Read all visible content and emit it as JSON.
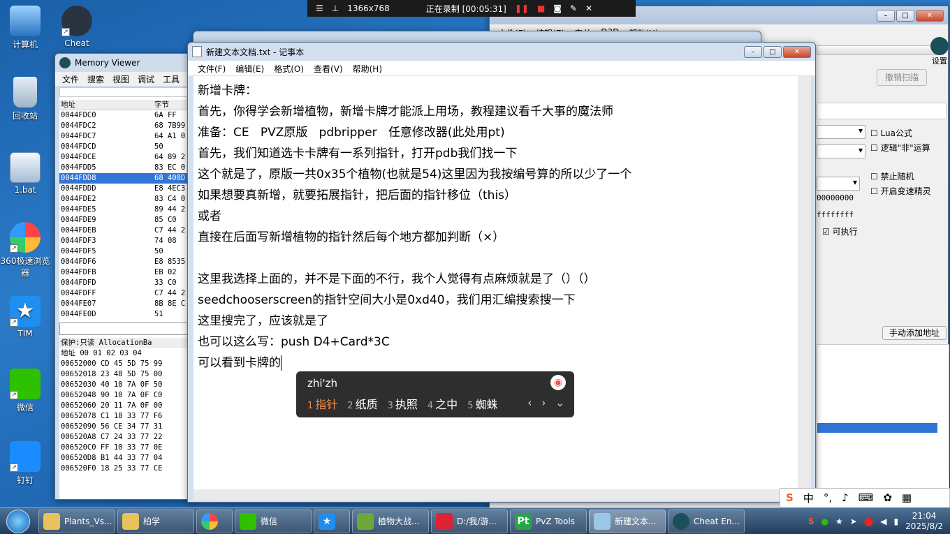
{
  "desktop": {
    "icons": [
      "计算机",
      "Cheat",
      "回收站",
      "1.bat",
      "360极速浏览器",
      "TIM",
      "微信",
      "钉钉"
    ]
  },
  "recorder": {
    "resolution": "1366x768",
    "status": "正在录制 [00:05:31]"
  },
  "memory_viewer": {
    "title": "Memory Viewer",
    "menu": [
      "文件",
      "搜索",
      "视图",
      "调试",
      "工具"
    ],
    "col_address": "地址",
    "col_bytes": "字节",
    "rows": [
      {
        "addr": "0044FDC0",
        "bytes": "6A FF"
      },
      {
        "addr": "0044FDC2",
        "bytes": "68 7B99"
      },
      {
        "addr": "0044FDC7",
        "bytes": "64 A1 0"
      },
      {
        "addr": "0044FDCD",
        "bytes": "50"
      },
      {
        "addr": "0044FDCE",
        "bytes": "64 89 2"
      },
      {
        "addr": "0044FDD5",
        "bytes": "83 EC 0"
      },
      {
        "addr": "0044FDD8",
        "bytes": "68 400D"
      },
      {
        "addr": "0044FDDD",
        "bytes": "E8 4EC3"
      },
      {
        "addr": "0044FDE2",
        "bytes": "83 C4 0"
      },
      {
        "addr": "0044FDE5",
        "bytes": "89 44 2"
      },
      {
        "addr": "0044FDE9",
        "bytes": "85 C0"
      },
      {
        "addr": "0044FDEB",
        "bytes": "C7 44 2"
      },
      {
        "addr": "0044FDF3",
        "bytes": "74 08"
      },
      {
        "addr": "0044FDF5",
        "bytes": "50"
      },
      {
        "addr": "0044FDF6",
        "bytes": "E8 8535"
      },
      {
        "addr": "0044FDFB",
        "bytes": "EB 02"
      },
      {
        "addr": "0044FDFD",
        "bytes": "33 C0"
      },
      {
        "addr": "0044FDFF",
        "bytes": "C7 44 2"
      },
      {
        "addr": "0044FE07",
        "bytes": "8B 8E C"
      },
      {
        "addr": "0044FE0D",
        "bytes": "51"
      }
    ],
    "selected_index": 6,
    "protect_label": "保护:只读   AllocationBa",
    "hex_header": "地址       00 01 02 03 04",
    "hex_rows": [
      "00652000 CD 45 5D 75 99",
      "00652018 23 48 5D 75 00",
      "00652030 40 10 7A 0F 50",
      "00652048 90 10 7A 0F C0",
      "00652060 20 11 7A 0F 00",
      "00652078 C1 18 33 77 F6",
      "00652090 56 CE 34 77 31",
      "006520A8 C7 24 33 77 22",
      "006520C0 FF 10 33 77 0E",
      "006520D8 B1 44 33 77 04",
      "006520F0 18 25 33 77 CE"
    ]
  },
  "cheat_engine": {
    "menu": [
      "文件(F)",
      "编辑(E)",
      "表单",
      "D3D",
      "帮助(H)"
    ],
    "settings_label": "设置",
    "undo_scan": "撤销扫描",
    "lua_formula": "Lua公式",
    "logic_not": "逻辑\"非\"运算",
    "disable_random": "禁止随机",
    "speedhack": "开启变速精灵",
    "hex_from": "00000000",
    "hex_to": "ffffffff",
    "executable": "可执行",
    "add_address": "手动添加地址"
  },
  "notepad": {
    "title": "新建文本文档.txt - 记事本",
    "menu": [
      "文件(F)",
      "编辑(E)",
      "格式(O)",
      "查看(V)",
      "帮助(H)"
    ],
    "lines": [
      "新增卡牌：",
      "首先，你得学会新增植物，新增卡牌才能派上用场，教程建议看千大事的魔法师",
      "准备：CE   PVZ原版   pdbripper   任意修改器(此处用pt)",
      "首先，我们知道选卡卡牌有一系列指针，打开pdb我们找一下",
      "这个就是了，原版一共0x35个植物(也就是54)这里因为我按编号算的所以少了一个",
      "如果想要真新增，就要拓展指针，把后面的指针移位（this）",
      "或者",
      "直接在后面写新增植物的指针然后每个地方都加判断（×）",
      "",
      "这里我选择上面的，并不是下面的不行，我个人觉得有点麻烦就是了（）（）",
      "seedchooserscreen的指针空间大小是0xd40，我们用汇编搜索搜一下",
      "这里搜完了，应该就是了",
      "也可以这么写：push D4+Card*3C",
      "可以看到卡牌的"
    ]
  },
  "ime": {
    "composition": "zhi'zh",
    "candidates": [
      {
        "n": "1",
        "text": "指针"
      },
      {
        "n": "2",
        "text": "纸质"
      },
      {
        "n": "3",
        "text": "执照"
      },
      {
        "n": "4",
        "text": "之中"
      },
      {
        "n": "5",
        "text": "蜘蛛"
      }
    ],
    "mode": "中"
  },
  "taskbar": {
    "items": [
      "Plants_Vs...",
      "柏学",
      "",
      "微信",
      "",
      "植物大战...",
      "D:/我/游...",
      "PvZ Tools",
      "新建文本...",
      "Cheat En..."
    ],
    "time": "21:04",
    "date": "2025/8/2"
  }
}
